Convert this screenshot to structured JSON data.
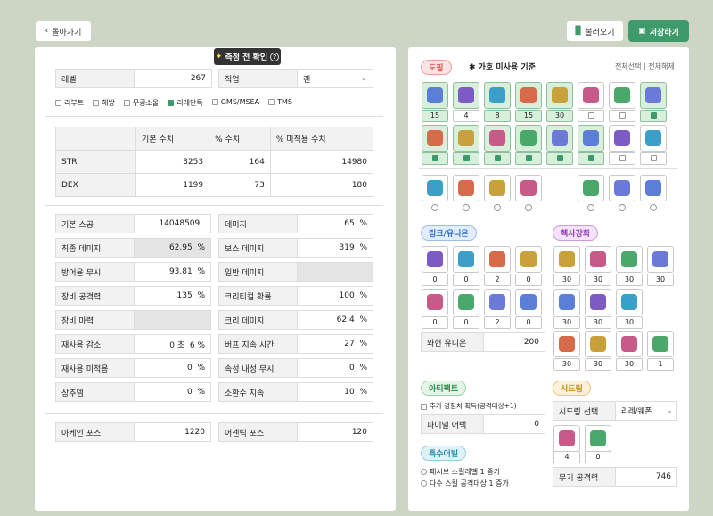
{
  "header": {
    "back": "돌아가기",
    "load": "불러오기",
    "save": "저장하기",
    "tooltip": "측정 전 확인"
  },
  "left": {
    "level_label": "레벨",
    "level": "267",
    "job_label": "직업",
    "job": "렌",
    "servers": [
      "리부트",
      "해방",
      "무공소울",
      "리레단독",
      "GMS/MSEA",
      "TMS"
    ],
    "stat_headers": [
      "기본 수치",
      "% 수치",
      "% 미적용 수치"
    ],
    "stats": [
      {
        "name": "STR",
        "base": "3253",
        "pct": "164",
        "flat": "14980"
      },
      {
        "name": "DEX",
        "base": "1199",
        "pct": "73",
        "flat": "180"
      }
    ],
    "rows_left": [
      {
        "label": "기본 스공",
        "value": "14048509",
        "unit": ""
      },
      {
        "label": "최종 데미지",
        "value": "62.95",
        "unit": "%"
      },
      {
        "label": "방어율 무시",
        "value": "93.81",
        "unit": "%"
      },
      {
        "label": "장비 공격력",
        "value": "135",
        "unit": "%"
      },
      {
        "label": "장비 마력",
        "value": "",
        "unit": ""
      },
      {
        "label": "재사용 감소",
        "value": "0 초",
        "unit": "6 %"
      },
      {
        "label": "재사용 미적용",
        "value": "0",
        "unit": "%"
      },
      {
        "label": "상추뎀",
        "value": "0",
        "unit": "%"
      }
    ],
    "rows_right": [
      {
        "label": "데미지",
        "value": "65",
        "unit": "%"
      },
      {
        "label": "보스 데미지",
        "value": "319",
        "unit": "%"
      },
      {
        "label": "일반 데미지",
        "value": "",
        "unit": ""
      },
      {
        "label": "크리티컬 확률",
        "value": "100",
        "unit": "%"
      },
      {
        "label": "크리 데미지",
        "value": "62.4",
        "unit": "%"
      },
      {
        "label": "버프 지속 시간",
        "value": "27",
        "unit": "%"
      },
      {
        "label": "속성 내성 무시",
        "value": "0",
        "unit": "%"
      },
      {
        "label": "소환수 지속",
        "value": "10",
        "unit": "%"
      }
    ],
    "arcane_label": "아케인 포스",
    "arcane": "1220",
    "authentic_label": "어센틱 포스",
    "authentic": "120"
  },
  "right": {
    "doping_tag": "도핑",
    "doping_note": "✱ 가호 미사용 기준",
    "select_all": "전체선택",
    "deselect_all": "전체해제",
    "doping_row1": [
      "15",
      "4",
      "8",
      "15",
      "30",
      "",
      "",
      ""
    ],
    "link_tag": "링크/유니온",
    "link_vals": [
      "0",
      "0",
      "2",
      "0",
      "0",
      "0",
      "2",
      "0"
    ],
    "hexa_tag": "헥사강화",
    "hexa_vals": [
      "30",
      "30",
      "30",
      "30",
      "30",
      "30",
      "30",
      "30",
      "30",
      "30",
      "1"
    ],
    "union_label": "와헌 유니온",
    "union": "200",
    "artifact_tag": "아티팩트",
    "artifact_opt": "추가 경험치 획득(공격대상+1)",
    "final_label": "파이널 어택",
    "final": "0",
    "seed_tag": "시드링",
    "seed_label": "시드링 선택",
    "seed": "리레/웨폰",
    "seed_vals": [
      "4",
      "0"
    ],
    "weapon_label": "무기 공격력",
    "weapon": "746",
    "special_tag": "특수어빌",
    "special_opts": [
      "패시브 스킬레벨 1 증가",
      "다수 스킬 공격대상 1 증가"
    ]
  },
  "colors": {
    "green": "#3e9a6a",
    "accent_red": "#d9534f"
  }
}
